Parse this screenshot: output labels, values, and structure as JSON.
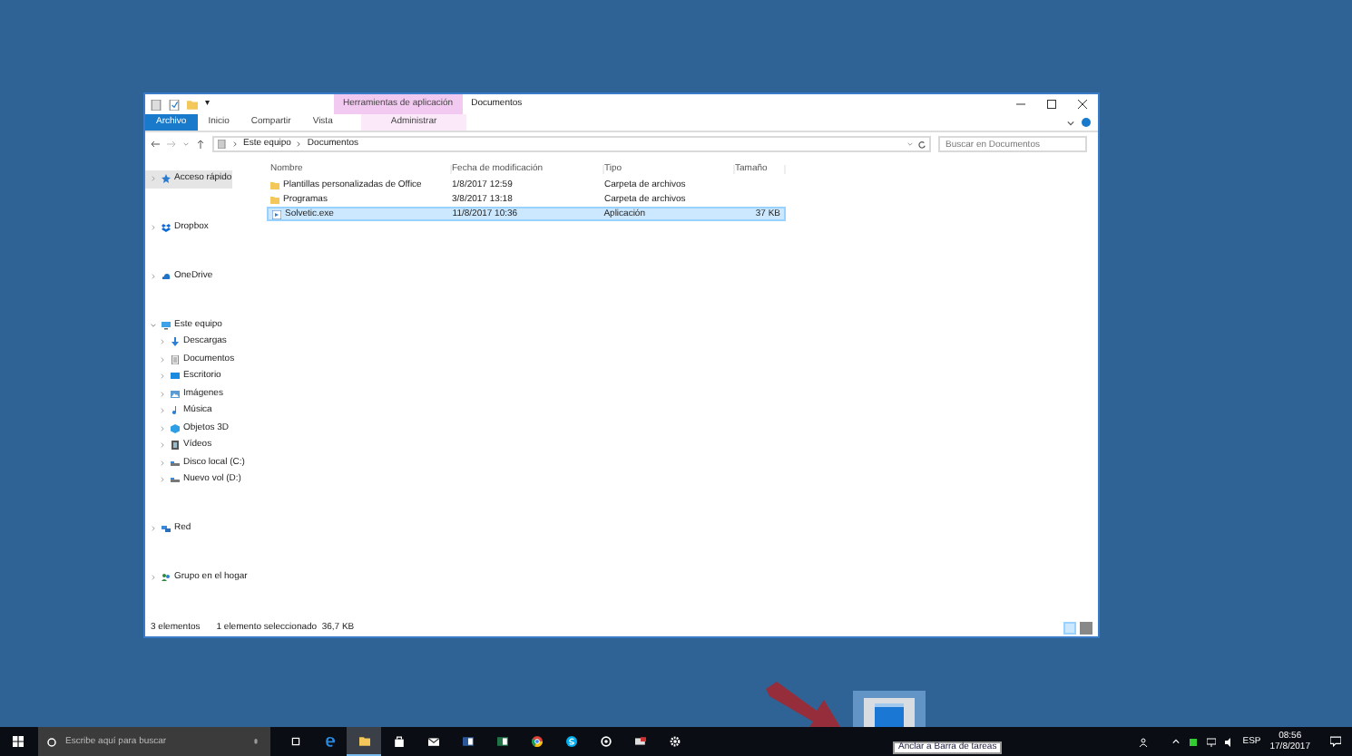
{
  "window": {
    "title": "Documentos",
    "context_group": "Herramientas de aplicación",
    "qat_caret": "▾",
    "ribbon_tabs": [
      {
        "label": "Archivo",
        "kind": "file",
        "selected": false
      },
      {
        "label": "Inicio",
        "kind": "normal",
        "selected": false
      },
      {
        "label": "Compartir",
        "kind": "normal",
        "selected": false
      },
      {
        "label": "Vista",
        "kind": "normal",
        "selected": false
      },
      {
        "label": "Administrar",
        "kind": "context",
        "selected": false
      }
    ]
  },
  "address": {
    "crumbs": [
      "Este equipo",
      "Documentos"
    ],
    "search": {
      "placeholder": "Buscar en Documentos"
    }
  },
  "navigation": [
    {
      "label": "Acceso rápido",
      "kind": "star",
      "selected": true,
      "expanded": false
    },
    {
      "label": "Dropbox",
      "kind": "dropbox",
      "selected": false,
      "expanded": false
    },
    {
      "label": "OneDrive",
      "kind": "cloud",
      "selected": false,
      "expanded": false
    },
    {
      "label": "Este equipo",
      "kind": "pc",
      "selected": false,
      "expanded": true,
      "children": [
        {
          "label": "Descargas",
          "kind": "download",
          "selected": false,
          "expanded": false
        },
        {
          "label": "Documentos",
          "kind": "document",
          "selected": false,
          "expanded": false
        },
        {
          "label": "Escritorio",
          "kind": "desktop",
          "selected": false,
          "expanded": false
        },
        {
          "label": "Imágenes",
          "kind": "image",
          "selected": false,
          "expanded": false
        },
        {
          "label": "Música",
          "kind": "music",
          "selected": false,
          "expanded": false
        },
        {
          "label": "Objetos 3D",
          "kind": "cube",
          "selected": false,
          "expanded": false
        },
        {
          "label": "Vídeos",
          "kind": "video",
          "selected": false,
          "expanded": false
        },
        {
          "label": "Disco local (C:)",
          "kind": "drive",
          "selected": false,
          "expanded": false
        },
        {
          "label": "Nuevo vol (D:)",
          "kind": "drive",
          "selected": false,
          "expanded": false
        }
      ]
    },
    {
      "label": "Red",
      "kind": "network",
      "selected": false,
      "expanded": false
    },
    {
      "label": "Grupo en el hogar",
      "kind": "group",
      "selected": false,
      "expanded": false
    }
  ],
  "files": {
    "columns": [
      "Nombre",
      "Fecha de modificación",
      "Tipo",
      "Tamaño"
    ],
    "rows": [
      {
        "name": "Plantillas personalizadas de Office",
        "date": "1/8/2017 12:59",
        "type": "Carpeta de archivos",
        "size": "",
        "kind": "folder",
        "selected": false
      },
      {
        "name": "Programas",
        "date": "3/8/2017 13:18",
        "type": "Carpeta de archivos",
        "size": "",
        "kind": "folder",
        "selected": false
      },
      {
        "name": "Solvetic.exe",
        "date": "11/8/2017 10:36",
        "type": "Aplicación",
        "size": "37 KB",
        "kind": "exe",
        "selected": true
      }
    ]
  },
  "status_bar": {
    "count": "3 elementos",
    "selection": "1 elemento seleccionado  36,7 KB"
  },
  "drag_tooltip": "Anclar a Barra de tareas",
  "taskbar": {
    "search": {
      "placeholder": "Escribe aquí para buscar"
    },
    "apps": [
      {
        "kind": "taskview",
        "active": false
      },
      {
        "kind": "edge",
        "active": false
      },
      {
        "kind": "explorer",
        "active": true
      },
      {
        "kind": "store",
        "active": false
      },
      {
        "kind": "mail",
        "active": false
      },
      {
        "kind": "word",
        "active": false
      },
      {
        "kind": "excel",
        "active": false
      },
      {
        "kind": "chrome",
        "active": false
      },
      {
        "kind": "skype",
        "active": false
      },
      {
        "kind": "ring",
        "active": false
      },
      {
        "kind": "remote",
        "active": false
      },
      {
        "kind": "settings",
        "active": false
      }
    ],
    "language": "ESP",
    "time": "08:56",
    "date": "17/8/2017"
  }
}
